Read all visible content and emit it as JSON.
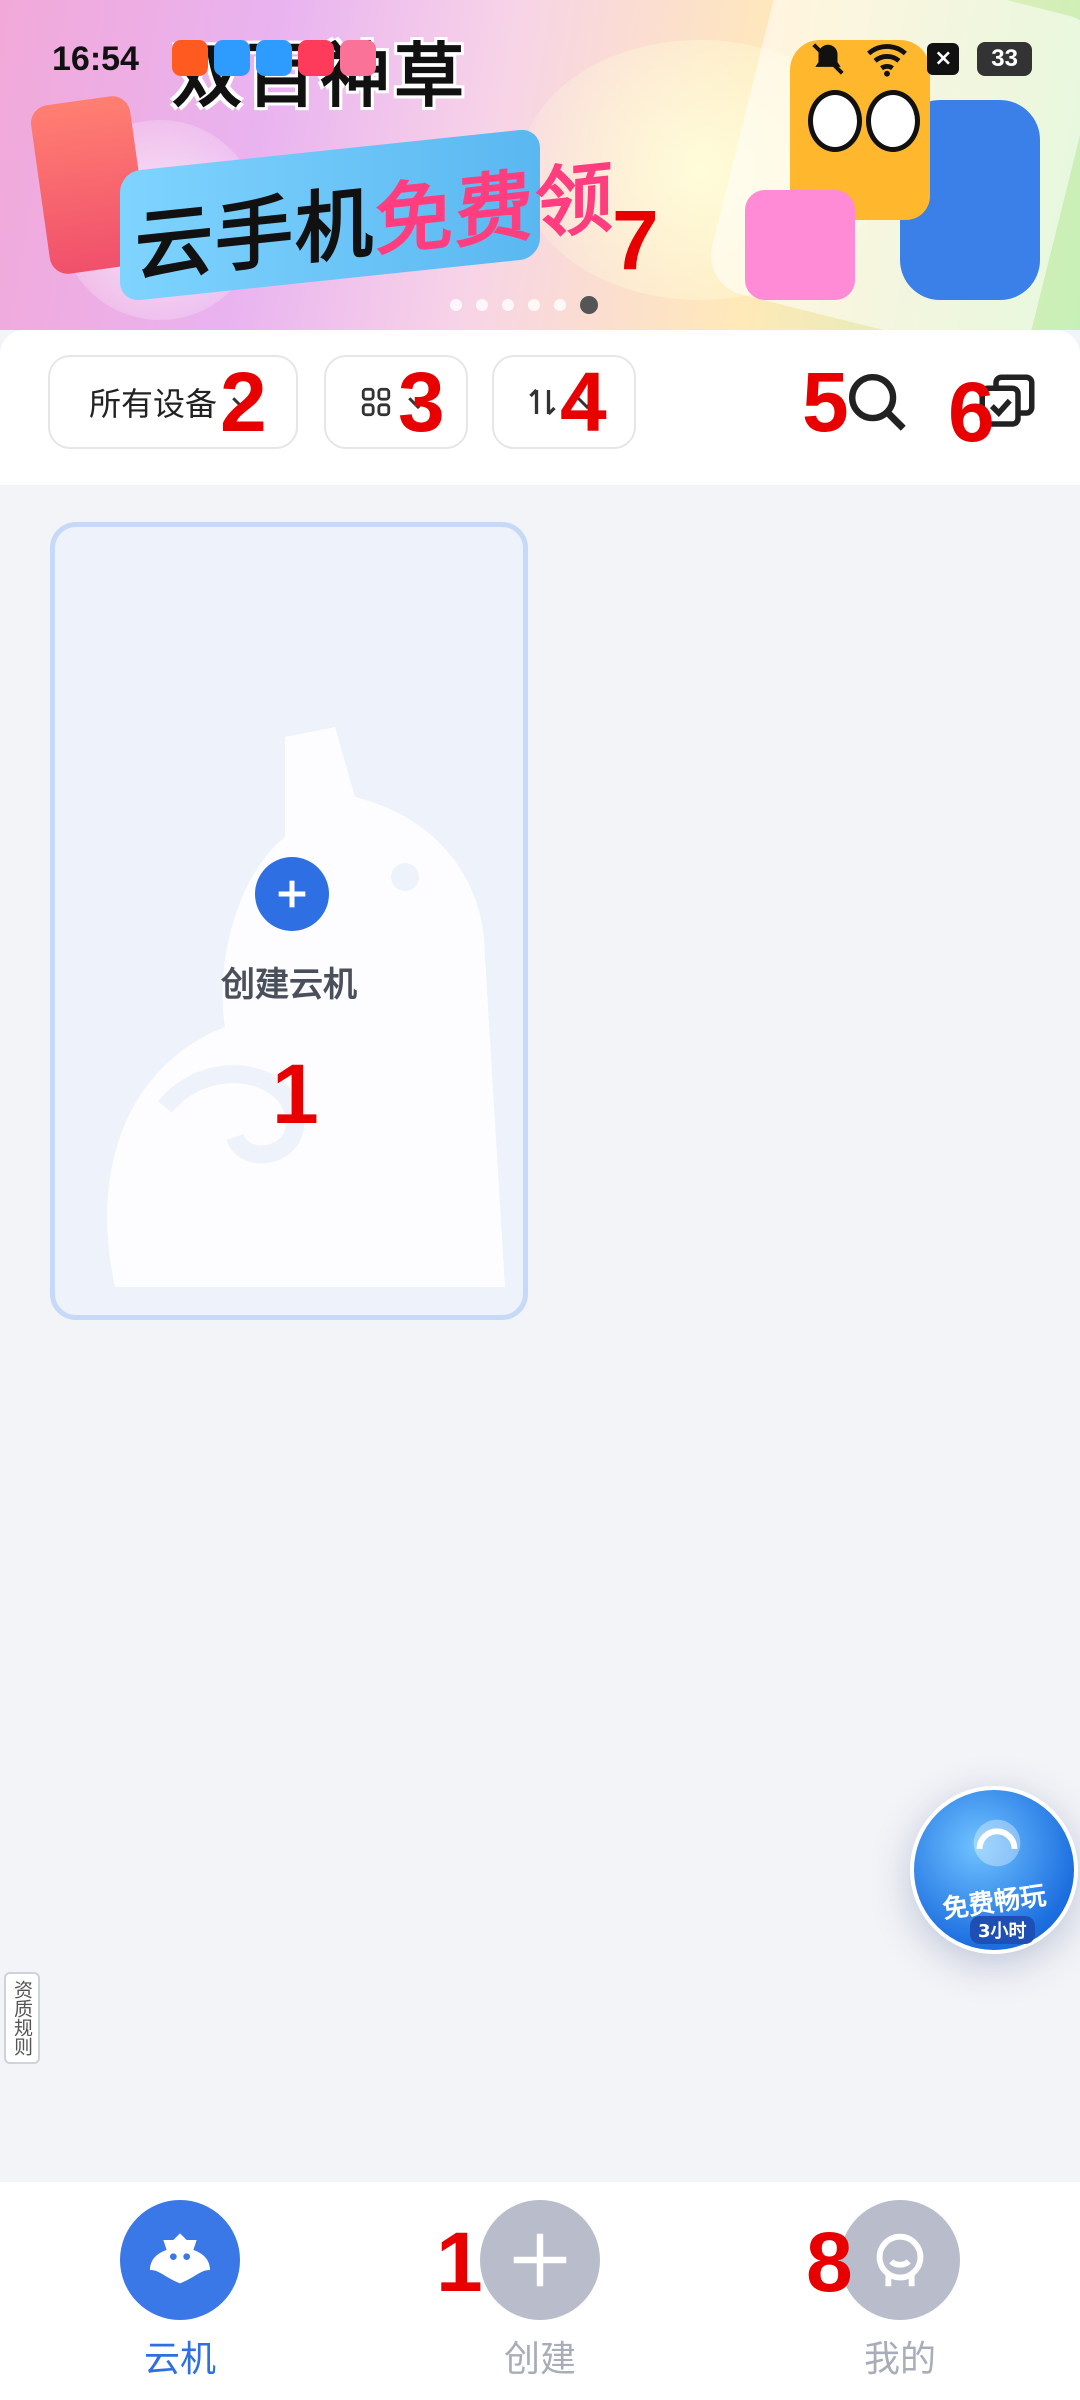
{
  "status_bar": {
    "time": "16:54",
    "battery": "33"
  },
  "banner": {
    "slogan": "双百神草",
    "headline_prefix": "云手机",
    "headline_highlight": "免费领",
    "page_dots": 6,
    "active_dot": 6
  },
  "toolbar": {
    "device_filter_label": "所有设备",
    "view_toggle_icon": "grid-icon",
    "sort_icon": "sort-icon",
    "search_icon": "search-icon",
    "multi_select_icon": "multi-select-icon"
  },
  "create_card": {
    "label": "创建云机"
  },
  "side_tag": {
    "label": "资质规则"
  },
  "promo": {
    "title": "免费畅玩",
    "subtitle": "3小时"
  },
  "bottom_nav": {
    "items": [
      {
        "label": "云机",
        "icon": "cloud-phone-icon",
        "active": true
      },
      {
        "label": "创建",
        "icon": "plus-icon",
        "active": false
      },
      {
        "label": "我的",
        "icon": "profile-icon",
        "active": false
      }
    ]
  },
  "markers": {
    "m1a": "1",
    "m1b": "1",
    "m2": "2",
    "m3": "3",
    "m4": "4",
    "m5": "5",
    "m6": "6",
    "m7": "7",
    "m8": "8"
  },
  "colors": {
    "accent": "#2f6fe4",
    "marker": "#e80000",
    "background": "#f3f4f8",
    "inactive_nav": "#b8bccb"
  }
}
